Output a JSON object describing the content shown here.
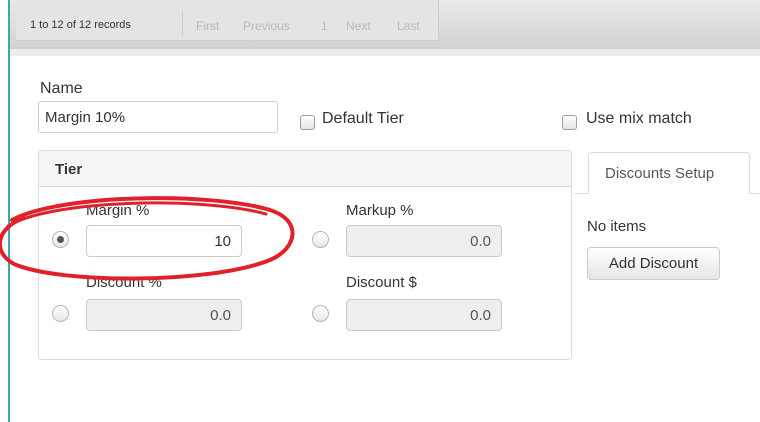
{
  "pager": {
    "record_count": "1 to 12 of 12 records",
    "first": "First",
    "previous": "Previous",
    "page": "1",
    "next": "Next",
    "last": "Last"
  },
  "form": {
    "name_label": "Name",
    "name_value": "Margin 10%",
    "default_tier_label": "Default Tier",
    "default_tier_checked": false,
    "use_mix_match_label": "Use mix match",
    "use_mix_match_checked": false
  },
  "tier": {
    "title": "Tier",
    "margin_label": "Margin %",
    "margin_value": "10",
    "margin_selected": true,
    "markup_label": "Markup %",
    "markup_value": "0.0",
    "discount_pct_label": "Discount %",
    "discount_pct_value": "0.0",
    "discount_amt_label": "Discount $",
    "discount_amt_value": "0.0"
  },
  "discounts": {
    "tab_label": "Discounts Setup",
    "empty_text": "No items",
    "add_button_label": "Add Discount"
  },
  "colors": {
    "annotation": "#e0202a",
    "edge_accent": "#3aa8b7"
  }
}
